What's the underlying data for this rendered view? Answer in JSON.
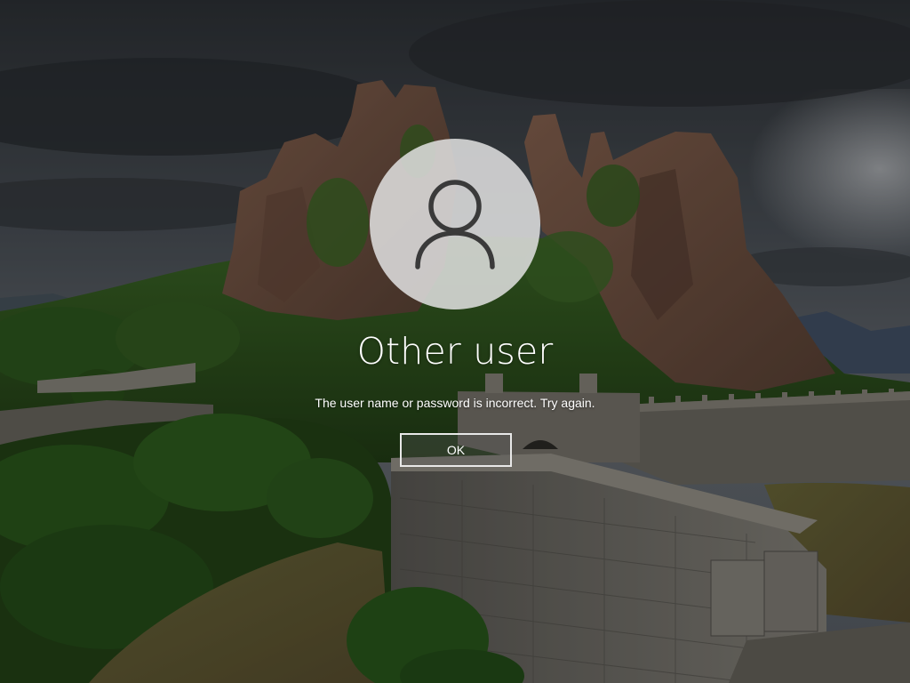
{
  "login": {
    "user_name": "Other user",
    "error_message": "The user name or password is incorrect. Try again.",
    "ok_label": "OK",
    "avatar_icon": "user-silhouette-icon"
  },
  "background": {
    "scene": "fortress-rocks-under-stormy-sky",
    "sky_color": "#4a5058",
    "foliage_color": "#3f6b2c",
    "rock_color": "#7a5a48",
    "wall_color": "#7d7a72"
  }
}
